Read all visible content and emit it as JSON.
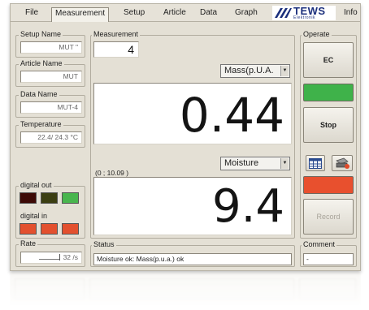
{
  "menu": {
    "items": [
      "File",
      "Measurement",
      "Setup",
      "Article",
      "Data",
      "Graph"
    ],
    "info": "Info",
    "logo": {
      "main": "TEWS",
      "sub": "Elektronik"
    }
  },
  "left": {
    "setup_name": {
      "label": "Setup Name",
      "value": "MUT \""
    },
    "article_name": {
      "label": "Article Name",
      "value": "MUT"
    },
    "data_name": {
      "label": "Data Name",
      "value": "MUT-4"
    },
    "temperature": {
      "label": "Temperature",
      "value": "22.4/ 24.3 °C"
    },
    "digital_out": {
      "label": "digital out",
      "colors": [
        "#3d0a06",
        "#3b3e12",
        "#49b64e"
      ]
    },
    "digital_in": {
      "label": "digital in",
      "colors": [
        "#e3502e",
        "#e3502e",
        "#e3502e"
      ]
    },
    "rate": {
      "label": "Rate",
      "value": "32 /s"
    }
  },
  "measurement": {
    "label": "Measurement",
    "count": "4",
    "select1": "Mass(p.U.A.",
    "value1": "0.44",
    "coords": "(0 ; 10.09 )",
    "select2": "Moisture",
    "value2": "9.4"
  },
  "operate": {
    "label": "Operate",
    "ec_label": "EC",
    "stop_label": "Stop",
    "record_label": "Record",
    "green_lamp": "#3fb24a",
    "red_lamp": "#e8502e",
    "table_icon": "table-icon",
    "print_icon": "printer-icon"
  },
  "status": {
    "label": "Status",
    "text": "Moisture ok: Mass(p.u.a.) ok"
  },
  "comment": {
    "label": "Comment",
    "value": "-"
  }
}
